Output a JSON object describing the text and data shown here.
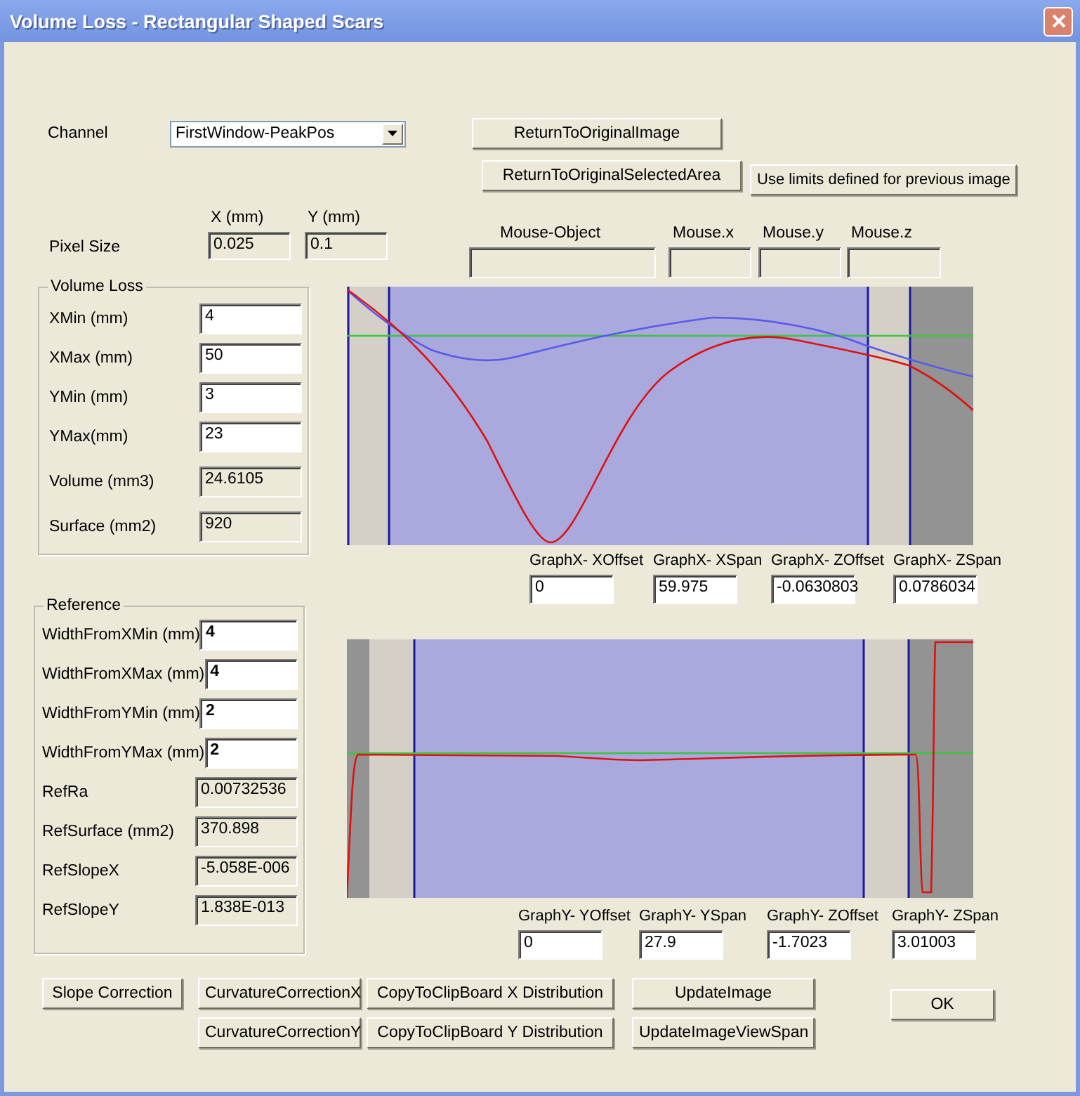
{
  "window": {
    "title": "Volume Loss - Rectangular Shaped Scars"
  },
  "channel": {
    "label": "Channel",
    "value": "FirstWindow-PeakPos"
  },
  "top_buttons": [
    {
      "label": "ReturnToOriginalImage"
    },
    {
      "label": "ReturnToOriginalSelectedArea"
    },
    {
      "label": "Use limits defined for previous image"
    }
  ],
  "pixel_size": {
    "label": "Pixel Size",
    "fields": [
      {
        "label": "X (mm)",
        "value": "0.025"
      },
      {
        "label": "Y (mm)",
        "value": "0.1"
      }
    ]
  },
  "mouse_fields": [
    {
      "label": "Mouse-Object"
    },
    {
      "label": "Mouse.x"
    },
    {
      "label": "Mouse.y"
    },
    {
      "label": "Mouse.z"
    }
  ],
  "volume_loss": {
    "title": "Volume Loss",
    "rows": [
      {
        "label": "XMin (mm)",
        "value": "4",
        "editable": true
      },
      {
        "label": "XMax (mm)",
        "value": "50",
        "editable": true
      },
      {
        "label": "YMin (mm)",
        "value": "3",
        "editable": true
      },
      {
        "label": "YMax(mm)",
        "value": "23",
        "editable": true
      },
      {
        "label": "Volume (mm3)",
        "value": "24.6105",
        "editable": false
      },
      {
        "label": "Surface (mm2)",
        "value": "920",
        "editable": false
      }
    ]
  },
  "reference": {
    "title": "Reference",
    "rows": [
      {
        "label": "WidthFromXMin (mm)",
        "value": "4",
        "editable": true
      },
      {
        "label": "WidthFromXMax (mm)",
        "value": "4",
        "editable": true
      },
      {
        "label": "WidthFromYMin (mm)",
        "value": "2",
        "editable": true
      },
      {
        "label": "WidthFromYMax (mm)",
        "value": "2",
        "editable": true
      },
      {
        "label": "RefRa",
        "value": "0.00732536",
        "editable": false
      },
      {
        "label": "RefSurface (mm2)",
        "value": "370.898",
        "editable": false
      },
      {
        "label": "RefSlopeX",
        "value": "-5.058E-006",
        "editable": false
      },
      {
        "label": "RefSlopeY",
        "value": "1.838E-013",
        "editable": false
      }
    ]
  },
  "graph_x": {
    "kind": "x",
    "fields": [
      {
        "label": "GraphX- XOffset",
        "value": "0"
      },
      {
        "label": "GraphX- XSpan",
        "value": "59.975"
      },
      {
        "label": "GraphX- ZOffset",
        "value": "-0.0630803"
      },
      {
        "label": "GraphX- ZSpan",
        "value": "0.0786034"
      }
    ]
  },
  "graph_y": {
    "kind": "y",
    "fields": [
      {
        "label": "GraphY- YOffset",
        "value": "0"
      },
      {
        "label": "GraphY- YSpan",
        "value": "27.9"
      },
      {
        "label": "GraphY- ZOffset",
        "value": "-1.7023"
      },
      {
        "label": "GraphY- ZSpan",
        "value": "3.01003"
      }
    ]
  },
  "bottom_buttons": [
    [
      "Slope Correction"
    ],
    [
      "CurvatureCorrectionX",
      "CurvatureCorrectionY"
    ],
    [
      "CopyToClipBoard X Distribution",
      "CopyToClipBoard Y Distribution"
    ],
    [
      "UpdateImage",
      "UpdateImageViewSpan"
    ],
    [
      "OK"
    ]
  ]
}
